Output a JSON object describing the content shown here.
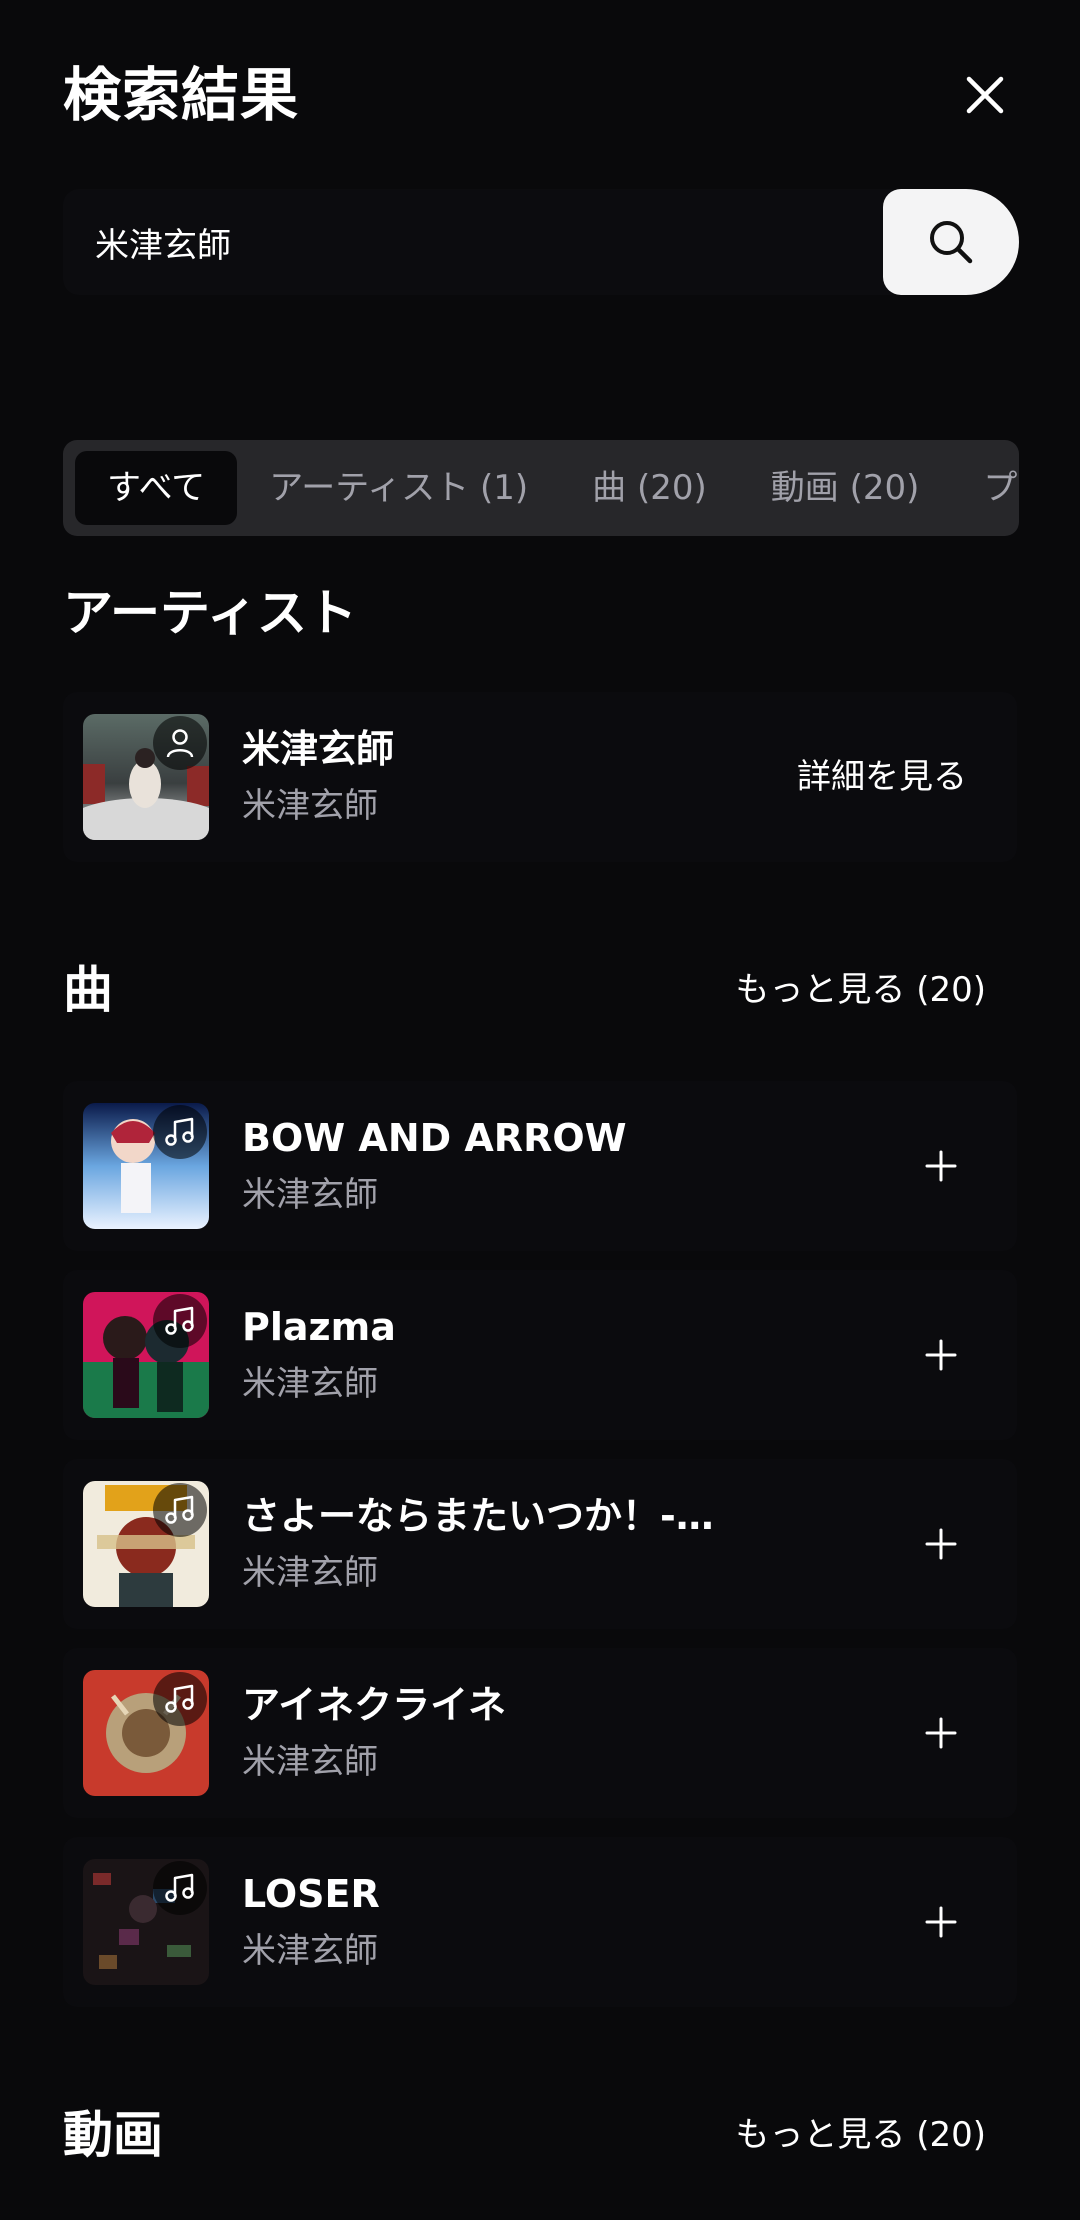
{
  "header": {
    "title": "検索結果"
  },
  "search": {
    "value": "米津玄師"
  },
  "tabs": [
    {
      "label": "すべて",
      "active": true
    },
    {
      "label": "アーティスト (1)"
    },
    {
      "label": "曲 (20)"
    },
    {
      "label": "動画 (20)"
    },
    {
      "label": "プ"
    }
  ],
  "artists": {
    "title": "アーティスト",
    "items": [
      {
        "name": "米津玄師",
        "sub": "米津玄師",
        "action": "詳細を見る"
      }
    ]
  },
  "songs": {
    "title": "曲",
    "more": "もっと見る (20)",
    "items": [
      {
        "title": "BOW AND ARROW",
        "artist": "米津玄師"
      },
      {
        "title": "Plazma",
        "artist": "米津玄師"
      },
      {
        "title": "さよーならまたいつか！-…",
        "artist": "米津玄師"
      },
      {
        "title": "アイネクライネ",
        "artist": "米津玄師"
      },
      {
        "title": "LOSER",
        "artist": "米津玄師"
      }
    ]
  },
  "videos": {
    "title": "動画",
    "more": "もっと見る (20)"
  },
  "icons": {
    "close": "close-icon",
    "search": "search-icon",
    "person": "person-icon",
    "note": "music-note-icon",
    "add": "plus-icon"
  }
}
